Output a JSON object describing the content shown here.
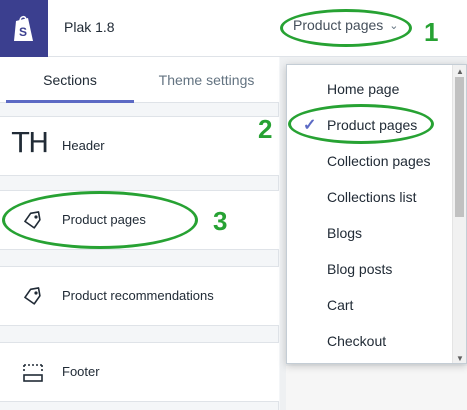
{
  "topbar": {
    "theme_name": "Plak 1.8",
    "page_select_label": "Product pages"
  },
  "tabs": [
    {
      "label": "Sections",
      "active": true
    },
    {
      "label": "Theme settings",
      "active": false
    }
  ],
  "header_logo_text": "TH",
  "sections": [
    {
      "label": "Header",
      "icon": "logo-thumbnail"
    },
    {
      "label": "Product pages",
      "icon": "tag-icon"
    },
    {
      "label": "Product recommendations",
      "icon": "tag-icon"
    },
    {
      "label": "Footer",
      "icon": "footer-layout-icon"
    }
  ],
  "dropdown": {
    "items": [
      {
        "label": "Home page",
        "selected": false
      },
      {
        "label": "Product pages",
        "selected": true
      },
      {
        "label": "Collection pages",
        "selected": false
      },
      {
        "label": "Collections list",
        "selected": false
      },
      {
        "label": "Blogs",
        "selected": false
      },
      {
        "label": "Blog posts",
        "selected": false
      },
      {
        "label": "Cart",
        "selected": false
      },
      {
        "label": "Checkout",
        "selected": false
      }
    ]
  },
  "annotations": [
    "1",
    "2",
    "3"
  ],
  "colors": {
    "annotation": "#27a233",
    "accent": "#5c6ac4",
    "logo_bg": "#3b3f8f"
  }
}
